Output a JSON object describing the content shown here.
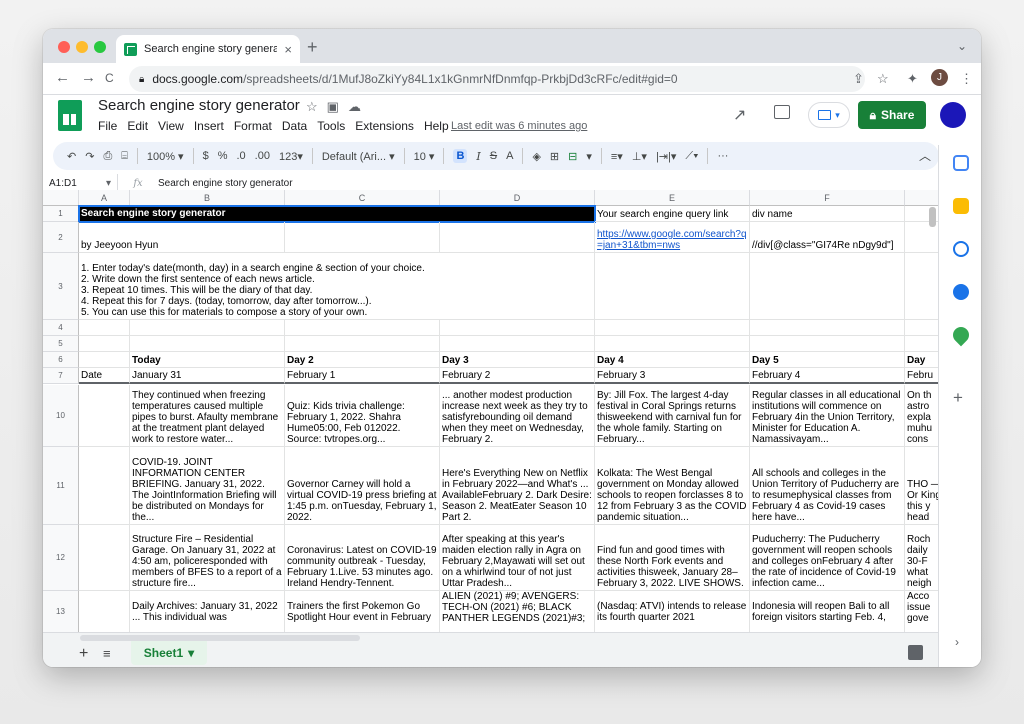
{
  "browser": {
    "tab_title": "Search engine story generator",
    "tab_close": "×",
    "new_tab": "+",
    "url_host": "docs.google.com",
    "url_path": "/spreadsheets/d/1MufJ8oZkiYy84L1x1kGnmrNfDnmfqp-PrkbjDd3cRFc/edit#gid=0",
    "profile_initial": "J",
    "nav": {
      "back": "←",
      "forward": "→",
      "reload": "C"
    }
  },
  "app": {
    "doc_title": "Search engine story generator",
    "menus": [
      "File",
      "Edit",
      "View",
      "Insert",
      "Format",
      "Data",
      "Tools",
      "Extensions",
      "Help"
    ],
    "last_edit": "Last edit was 6 minutes ago",
    "share_label": "Share",
    "brand_color": "#0f9d58"
  },
  "toolbar": {
    "zoom": "100%",
    "currency": "$",
    "percent": "%",
    "dec_less": ".0",
    "dec_more": ".00",
    "format": "123",
    "font": "Default (Ari...",
    "font_size": "10",
    "bold": "B",
    "italic": "I",
    "strike": "S",
    "text_color": "A",
    "more": "···"
  },
  "formula_bar": {
    "name_box": "A1:D1",
    "fx": "fx",
    "value": "Search engine story generator"
  },
  "columns": [
    "A",
    "B",
    "C",
    "D",
    "E",
    "F"
  ],
  "rows": {
    "r1": {
      "num": "1",
      "title": "Search engine story generator",
      "e": "Your search engine query link",
      "f": "div name"
    },
    "r2": {
      "num": "2",
      "a": "by Jeeyoon Hyun",
      "e": "https://www.google.com/search?q=jan+31&tbm=nws",
      "f": "//div[@class=\"GI74Re nDgy9d\"]"
    },
    "r3": {
      "num": "3",
      "lines": [
        "1. Enter today's date(month, day) in a search engine & section of your choice.",
        "2. Write down the first sentence of each news article.",
        "3. Repeat 10 times. This will be the diary of that day.",
        "4. Repeat this for 7 days. (today, tomorrow, day after tomorrow...).",
        "5. You can use this for materials to compose a story of your own."
      ]
    },
    "r4": {
      "num": "4"
    },
    "r5": {
      "num": "5"
    },
    "r6": {
      "num": "6",
      "days": [
        "Today",
        "Day 2",
        "Day 3",
        "Day 4",
        "Day 5",
        "Day"
      ]
    },
    "r7": {
      "num": "7",
      "label": "Date",
      "dates": [
        "January 31",
        "February 1",
        "February 2",
        "February 3",
        "February 4",
        "Febru"
      ]
    },
    "r10": {
      "num": "10",
      "cells": [
        "They continued when freezing temperatures caused multiple pipes to burst. Afaulty membrane at the treatment plant delayed work to restore water...",
        "Quiz: Kids trivia challenge: February 1, 2022. Shahra Hume05:00, Feb 012022. Source: tvtropes.org...",
        "... another modest production increase next week as they try to satisfyrebounding oil demand when they meet on Wednesday, February 2.",
        "By: Jill Fox. The largest 4-day festival in Coral Springs returns thisweekend with carnival fun for the whole family. Starting on February...",
        "Regular classes in all educational institutions will commence on February 4in the Union Territory, Minister for Education A. Namassivayam...",
        "On th astro expla muhu cons"
      ]
    },
    "r11": {
      "num": "11",
      "cells": [
        "COVID-19. JOINT INFORMATION CENTER BRIEFING. January 31, 2022. The JointInformation Briefing will be distributed on Mondays for the...",
        "Governor Carney will hold a virtual COVID-19 press briefing at 1:45 p.m. onTuesday, February 1, 2022.",
        "Here's Everything New on Netflix in February 2022—and What's ... AvailableFebruary 2. Dark Desire: Season 2. MeatEater Season 10 Part 2.",
        "Kolkata: The West Bengal government on Monday allowed schools to reopen forclasses 8 to 12 from February 3 as the COVID pandemic situation...",
        "All schools and colleges in the Union Territory of Puducherry are to resumephysical classes from February 4 as Covid-19 cases here have...",
        "THO —Or King this y head"
      ]
    },
    "r12": {
      "num": "12",
      "cells": [
        "Structure Fire – Residential Garage. On January 31, 2022 at 4:50 am, policeresponded with members of BFES to a report of a structure fire...",
        "Coronavirus: Latest on COVID-19 community outbreak - Tuesday, February 1.Live. 53 minutes ago. Ireland Hendry-Tennent.",
        "After speaking at this year's maiden election rally in Agra on February 2,Mayawati will set out on a whirlwind tour of not just Uttar Pradesh...",
        "Find fun and good times with these North Fork events and activities thisweek, January 28–February 3, 2022. LIVE SHOWS.",
        "Puducherry: The Puducherry government will reopen schools and colleges onFebruary 4 after the rate of incidence of Covid-19 infection came...",
        "Roch daily 30-F what neigh"
      ]
    },
    "r13": {
      "num": "13",
      "cells": [
        "Daily Archives: January 31, 2022 ... This individual was",
        "Trainers the first Pokemon Go Spotlight Hour event in February",
        "ALIEN (2021) #9; AVENGERS: TECH-ON (2021) #6; BLACK PANTHER LEGENDS (2021)#3;",
        "(Nasdaq: ATVI) intends to release its fourth quarter 2021",
        "Indonesia will reopen Bali to all foreign visitors starting Feb. 4,",
        "Acco issue gove"
      ]
    }
  },
  "sheet_tab": "Sheet1"
}
